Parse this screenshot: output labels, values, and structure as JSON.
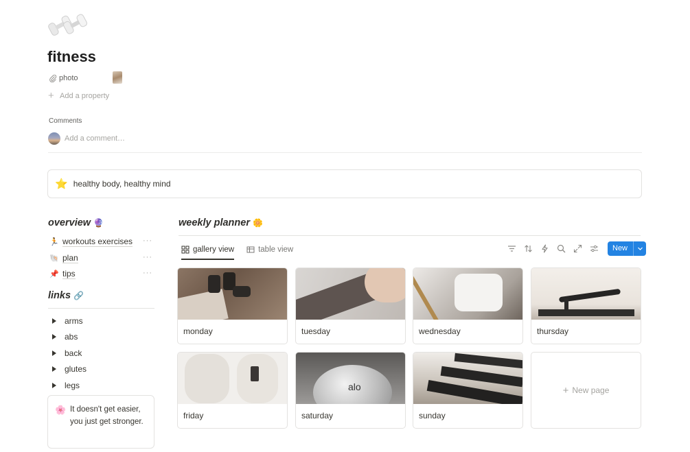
{
  "page": {
    "icon": "dumbbell-icon",
    "title": "fitness"
  },
  "properties": {
    "photo_label": "photo",
    "add_property": "Add a property"
  },
  "comments": {
    "label": "Comments",
    "placeholder": "Add a comment…"
  },
  "callout": {
    "emoji": "⭐",
    "text": "healthy body, healthy mind"
  },
  "overview": {
    "heading": "overview",
    "heading_emoji": "🔮",
    "items": [
      {
        "emoji": "🏃",
        "label": "workouts exercises"
      },
      {
        "emoji": "🐚",
        "label": "plan"
      },
      {
        "emoji": "📌",
        "label": "tips"
      }
    ],
    "more_glyph": "···"
  },
  "links": {
    "heading": "links",
    "heading_emoji": "🔗",
    "items": [
      "arms",
      "abs",
      "back",
      "glutes",
      "legs"
    ]
  },
  "quote": {
    "emoji": "🌸",
    "text": "It doesn't get easier, you just get stronger."
  },
  "planner": {
    "heading": "weekly planner",
    "heading_emoji": "🌼",
    "tabs": [
      {
        "label": "gallery view",
        "icon": "gallery-grid-icon",
        "active": true
      },
      {
        "label": "table view",
        "icon": "table-icon",
        "active": false
      }
    ],
    "toolbar_icons": [
      "filter-icon",
      "sort-icon",
      "automation-bolt-icon",
      "search-icon",
      "expand-icon",
      "settings-sliders-icon"
    ],
    "new_button": "New",
    "accent": "#2383e2",
    "cards": [
      {
        "name": "monday",
        "image": "dumbbells-on-floor"
      },
      {
        "name": "tuesday",
        "image": "leggings-stretch"
      },
      {
        "name": "wednesday",
        "image": "barre-clothing"
      },
      {
        "name": "thursday",
        "image": "yoga-pose-room"
      },
      {
        "name": "friday",
        "image": "boxing-gloves"
      },
      {
        "name": "saturday",
        "image": "alo-exercise-ball"
      },
      {
        "name": "sunday",
        "image": "treadmill-gym"
      }
    ],
    "new_page": "New page"
  }
}
